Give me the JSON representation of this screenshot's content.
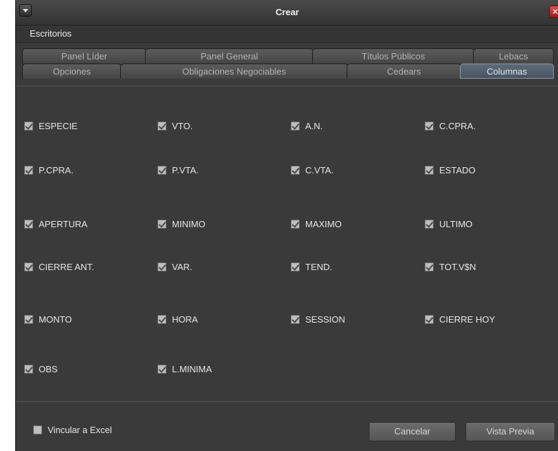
{
  "window": {
    "title": "Crear"
  },
  "menu": {
    "items": [
      "Escritorios"
    ]
  },
  "tabs": {
    "row1": [
      "Panel Líder",
      "Panel General",
      "Títulos Públicos",
      "Lebacs"
    ],
    "row2": [
      "Opciones",
      "Obligaciones Negociables",
      "Cedears",
      "Columnas"
    ],
    "active": "Columnas"
  },
  "columns": [
    {
      "label": "ESPECIE",
      "checked": true
    },
    {
      "label": "VTO.",
      "checked": true
    },
    {
      "label": "A.N.",
      "checked": true
    },
    {
      "label": "C.CPRA.",
      "checked": true
    },
    {
      "label": "P.CPRA.",
      "checked": true
    },
    {
      "label": "P.VTA.",
      "checked": true
    },
    {
      "label": "C.VTA.",
      "checked": true
    },
    {
      "label": "ESTADO",
      "checked": true
    },
    {
      "label": "APERTURA",
      "checked": true
    },
    {
      "label": "MINIMO",
      "checked": true
    },
    {
      "label": "MAXIMO",
      "checked": true
    },
    {
      "label": "ULTIMO",
      "checked": true
    },
    {
      "label": "CIERRE ANT.",
      "checked": true
    },
    {
      "label": "VAR.",
      "checked": true
    },
    {
      "label": "TEND.",
      "checked": true
    },
    {
      "label": "TOT.V$N",
      "checked": true
    },
    {
      "label": "MONTO",
      "checked": true
    },
    {
      "label": "HORA",
      "checked": true
    },
    {
      "label": "SESSION",
      "checked": true
    },
    {
      "label": "CIERRE HOY",
      "checked": true
    },
    {
      "label": "OBS",
      "checked": true
    },
    {
      "label": "L.MINIMA",
      "checked": true
    }
  ],
  "footer": {
    "link_excel": {
      "label": "Vincular a Excel",
      "checked": false
    },
    "cancel_label": "Cancelar",
    "preview_label": "Vista Previa"
  },
  "colors": {
    "background": "#3a3a3a",
    "active_tab": "#4f5a68",
    "close": "#c82828"
  }
}
